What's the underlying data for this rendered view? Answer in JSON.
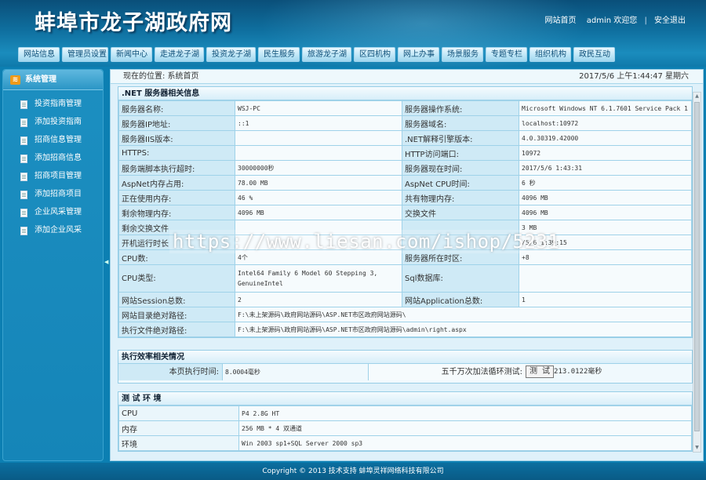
{
  "header": {
    "site_title": "蚌埠市龙子湖政府网",
    "links": {
      "home": "网站首页",
      "user": "admin 欢迎您",
      "separator": "|",
      "logout": "安全退出"
    },
    "nav_tabs": [
      "网站信息",
      "管理员设置",
      "新闻中心",
      "走进龙子湖",
      "投资龙子湖",
      "民生服务",
      "旅游龙子湖",
      "区四机构",
      "网上办事",
      "场景服务",
      "专题专栏",
      "组织机构",
      "政民互动"
    ]
  },
  "sidebar": {
    "title": "系统管理",
    "items": [
      "投资指南管理",
      "添加投资指南",
      "招商信息管理",
      "添加招商信息",
      "招商项目管理",
      "添加招商项目",
      "企业风采管理",
      "添加企业风采"
    ]
  },
  "breadcrumb": {
    "location": "现在的位置: 系统首页",
    "datetime": "2017/5/6 上午1:44:47 星期六"
  },
  "server_panel": {
    "title": ".NET 服务器相关信息",
    "rows": [
      [
        "服务器名称:",
        "WSJ-PC",
        "服务器操作系统:",
        "Microsoft Windows NT 6.1.7601 Service Pack 1"
      ],
      [
        "服务器IP地址:",
        "::1",
        "服务器域名:",
        "localhost:10972"
      ],
      [
        "服务器IIS版本:",
        "",
        ".NET解释引擎版本:",
        "4.0.30319.42000"
      ],
      [
        "HTTPS:",
        "",
        "HTTP访问端口:",
        "10972"
      ],
      [
        "服务端脚本执行超时:",
        "30000000秒",
        "服务器现在时间:",
        "2017/5/6 1:43:31"
      ],
      [
        "AspNet内存占用:",
        "78.00 MB",
        "AspNet CPU时间:",
        "6 秒"
      ],
      [
        "正在使用内存:",
        "46 %",
        "共有物理内存:",
        "4096 MB"
      ],
      [
        "剩余物理内存:",
        "4096 MB",
        "交换文件",
        "4096 MB"
      ],
      [
        "剩余交换文件",
        "",
        "",
        "3 MB"
      ],
      [
        "开机运行时长",
        "",
        "",
        "/5/6 1:39:15"
      ],
      [
        "CPU数:",
        "4个",
        "服务器所在时区:",
        "+8"
      ],
      [
        "CPU类型:",
        "Intel64 Family 6 Model 60 Stepping 3, GenuineIntel",
        "Sql数据库:",
        ""
      ],
      [
        "网站Session总数:",
        "2",
        "网站Application总数:",
        "1"
      ]
    ],
    "wide_rows": [
      [
        "网站目录绝对路径:",
        "F:\\未上架源码\\政府网站源码\\ASP.NET市区政府网站源码\\"
      ],
      [
        "执行文件绝对路径:",
        "F:\\未上架源码\\政府网站源码\\ASP.NET市区政府网站源码\\admin\\right.aspx"
      ]
    ]
  },
  "efficiency_panel": {
    "title": "执行效率相关情况",
    "page_time_label": "本页执行时间:",
    "page_time_value": "8.0004毫秒",
    "loop_label": "五千万次加法循环测试:",
    "test_button": "测 试",
    "loop_value": "213.0122毫秒"
  },
  "env_panel": {
    "title": "测 试 环 境",
    "rows": [
      [
        "CPU",
        "P4 2.8G HT"
      ],
      [
        "内存",
        "256 MB * 4 双通道"
      ],
      [
        "环境",
        "Win 2003 sp1+SQL Server 2000 sp3"
      ]
    ]
  },
  "watermark": "https://www.liesan.com/ishop/5231",
  "footer": "Copyright © 2013 技术支持 蚌埠灵祥网络科技有限公司"
}
